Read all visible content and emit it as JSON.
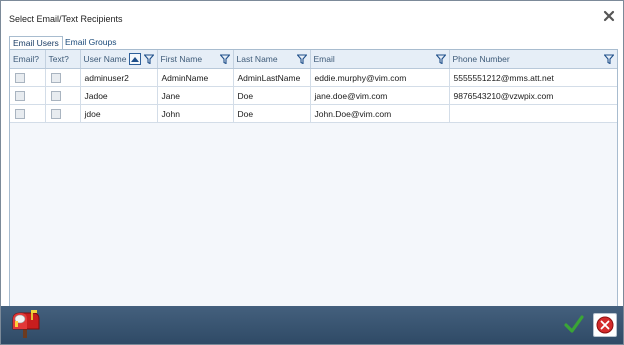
{
  "window": {
    "title": "Select Email/Text Recipients"
  },
  "tabs": [
    {
      "label": "Email Users",
      "active": true
    },
    {
      "label": "Email Groups",
      "active": false
    }
  ],
  "grid": {
    "columns": [
      "Email?",
      "Text?",
      "User Name",
      "First Name",
      "Last Name",
      "Email",
      "Phone Number"
    ],
    "sort": {
      "column": "User Name",
      "direction": "ascending"
    },
    "rows": [
      {
        "email_checked": false,
        "text_checked": false,
        "username": "adminuser2",
        "first": "AdminName",
        "last": "AdminLastName",
        "email": "eddie.murphy@vim.com",
        "phone": "5555551212@mms.att.net"
      },
      {
        "email_checked": false,
        "text_checked": false,
        "username": "Jadoe",
        "first": "Jane",
        "last": "Doe",
        "email": "jane.doe@vim.com",
        "phone": "9876543210@vzwpix.com"
      },
      {
        "email_checked": false,
        "text_checked": false,
        "username": "jdoe",
        "first": "John",
        "last": "Doe",
        "email": "John.Doe@vim.com",
        "phone": ""
      }
    ]
  },
  "icons": {
    "close": "close-icon",
    "filter": "filter-icon",
    "sort": "sort-ascending-icon",
    "logo": "mailbox-icon",
    "ok": "checkmark-icon",
    "cancel": "cancel-icon"
  },
  "colors": {
    "footer": "#3a5673",
    "header": "#e6eef7",
    "ok_green": "#3aa536",
    "cancel_red": "#d42a2a"
  }
}
